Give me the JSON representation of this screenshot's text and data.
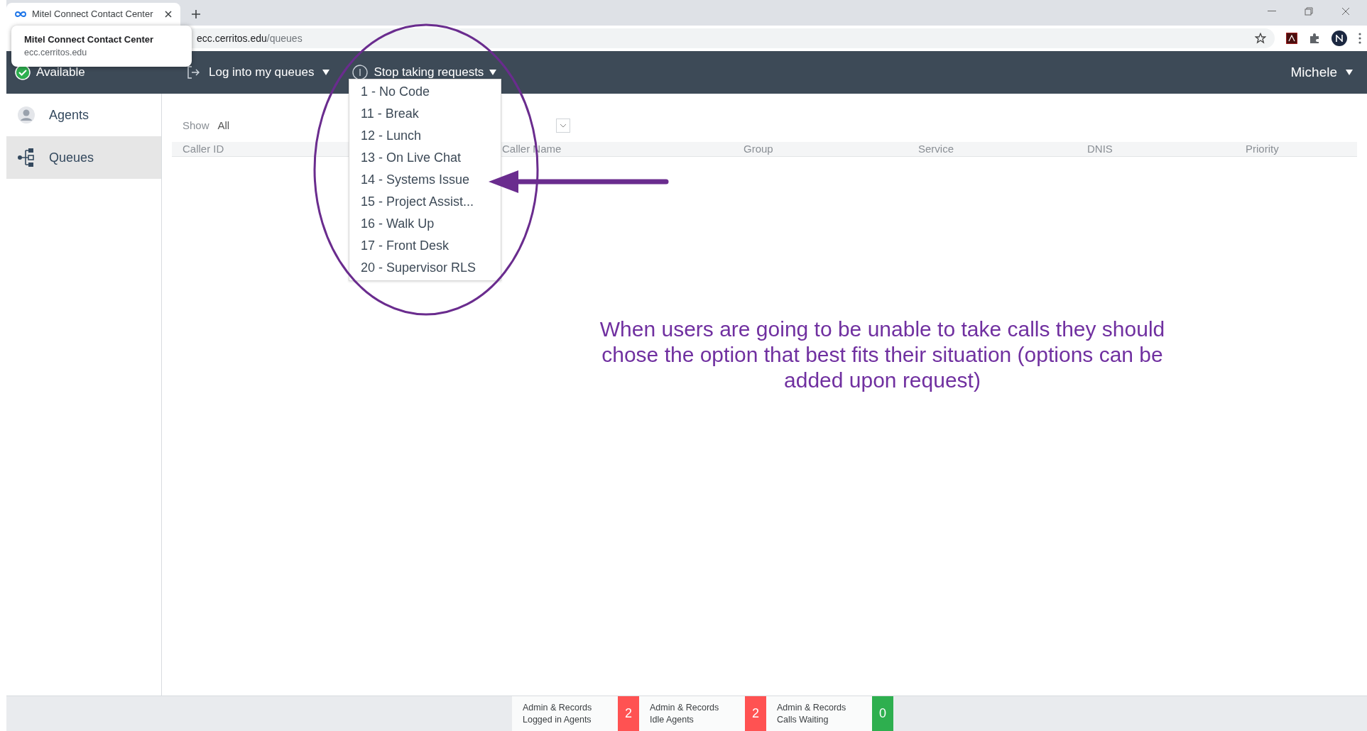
{
  "browser": {
    "tab_title": "Mitel Connect Contact Center",
    "url_host": "ecc.cerritos.edu",
    "url_path": "/queues"
  },
  "tab_tooltip": {
    "title": "Mitel Connect Contact Center",
    "host": "ecc.cerritos.edu"
  },
  "header": {
    "status": "Available",
    "login_action": "Log into my queues",
    "stop_action": "Stop taking requests",
    "user": "Michele"
  },
  "dropdown": {
    "items": [
      {
        "label": "1 - No Code"
      },
      {
        "label": "11 - Break"
      },
      {
        "label": "12 - Lunch"
      },
      {
        "label": "13 - On Live Chat"
      },
      {
        "label": "14 - Systems Issue"
      },
      {
        "label": "15 - Project Assist..."
      },
      {
        "label": "16 - Walk Up"
      },
      {
        "label": "17 - Front Desk"
      },
      {
        "label": "20 - Supervisor RLS"
      }
    ]
  },
  "sidebar": {
    "items": [
      {
        "label": "Agents",
        "kind": "person",
        "selected": false
      },
      {
        "label": "Queues",
        "kind": "tree",
        "selected": true
      }
    ]
  },
  "filter": {
    "label": "Show",
    "value": "All"
  },
  "table": {
    "columns": [
      {
        "label": "Caller ID"
      },
      {
        "label": "Caller Name"
      },
      {
        "label": "Group"
      },
      {
        "label": "Service"
      },
      {
        "label": "DNIS"
      },
      {
        "label": "Priority"
      }
    ]
  },
  "annotation": "When users are going to be unable to take calls they should chose the option that best fits their situation (options can be added upon request)",
  "status_bar": [
    {
      "group": "Admin & Records",
      "metric": "Logged in Agents",
      "count": "2",
      "color": "#ff5252"
    },
    {
      "group": "Admin & Records",
      "metric": "Idle Agents",
      "count": "2",
      "color": "#ff5252"
    },
    {
      "group": "Admin & Records",
      "metric": "Calls Waiting",
      "count": "0",
      "color": "#2eaf4f"
    }
  ]
}
